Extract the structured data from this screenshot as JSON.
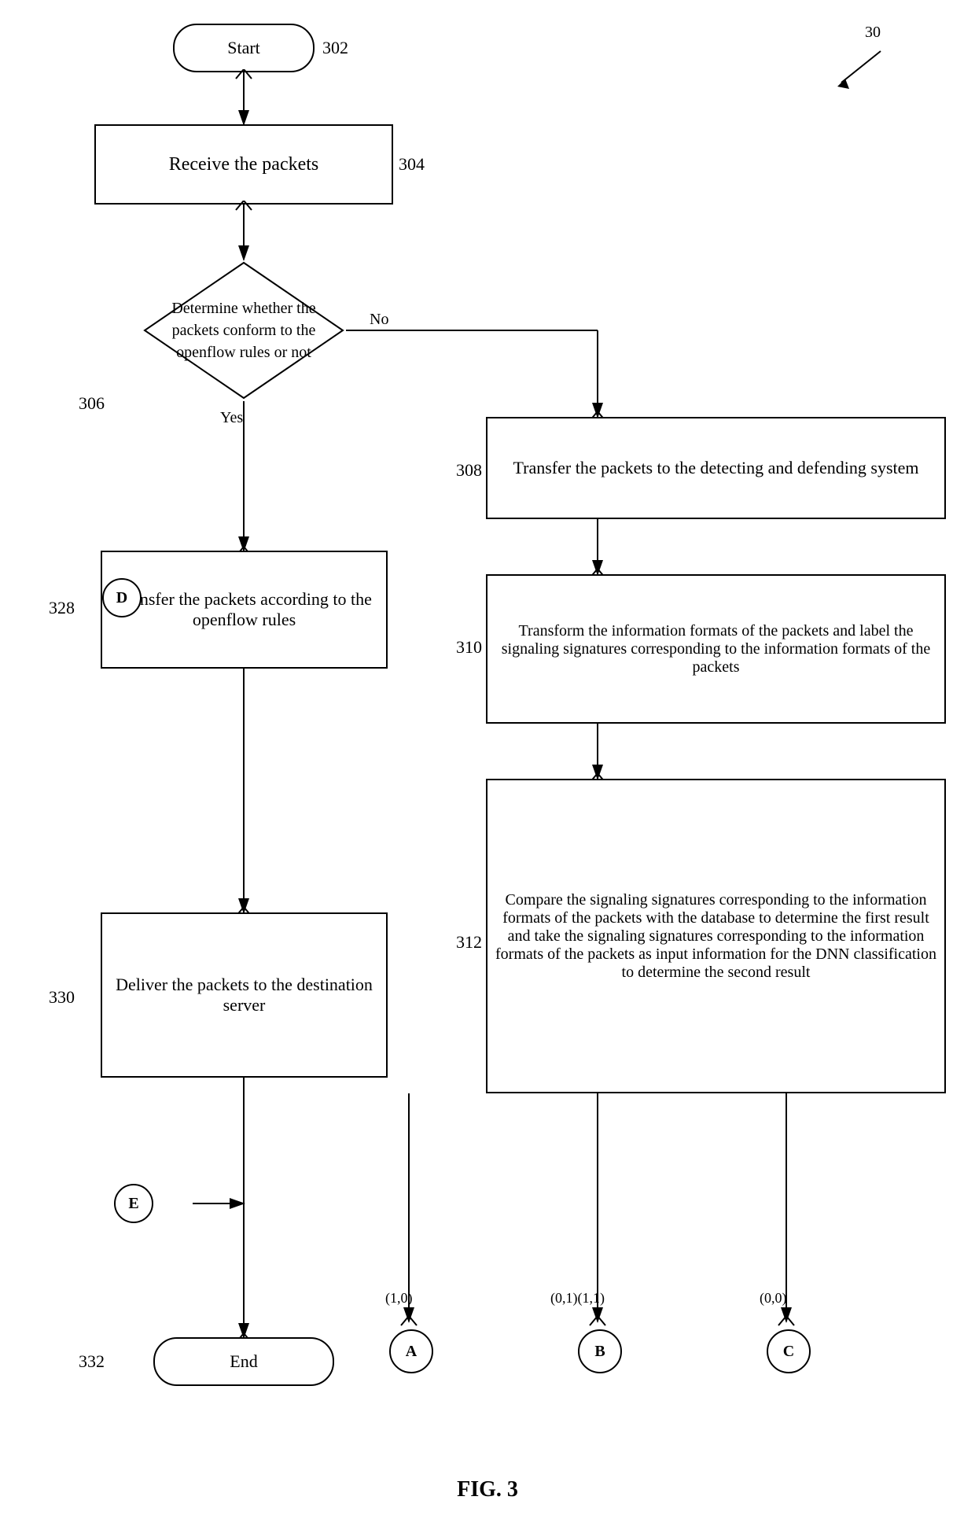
{
  "figure": {
    "number": "30",
    "caption": "FIG. 3"
  },
  "nodes": {
    "start": {
      "label": "Start",
      "ref": "302"
    },
    "receive": {
      "label": "Receive the packets",
      "ref": "304"
    },
    "decision": {
      "label": "Determine whether the packets conform to the openflow rules or not",
      "ref": "306",
      "yes_label": "Yes",
      "no_label": "No"
    },
    "transfer_detecting": {
      "label": "Transfer the packets to the detecting and defending system",
      "ref": "308"
    },
    "transform": {
      "label": "Transform the information formats of the packets and label the signaling signatures corresponding to the information formats of the packets",
      "ref": "310"
    },
    "compare": {
      "label": "Compare the signaling signatures corresponding to the information formats of the packets with the database to determine the first result and take the signaling signatures corresponding to the information formats of the packets as input information for the DNN classification to determine the second result",
      "ref": "312"
    },
    "transfer_openflow": {
      "label": "Transfer the packets according to the openflow rules",
      "ref": "328"
    },
    "deliver": {
      "label": "Deliver the packets to the destination server",
      "ref": "330"
    },
    "end": {
      "label": "End",
      "ref": "332"
    }
  },
  "connectors": {
    "A": {
      "label": "A",
      "sub": "(1,0)"
    },
    "B": {
      "label": "B",
      "sub": "(0,1)(1,1)"
    },
    "C": {
      "label": "C",
      "sub": "(0,0)"
    },
    "D": {
      "label": "D"
    },
    "E": {
      "label": "E"
    }
  }
}
